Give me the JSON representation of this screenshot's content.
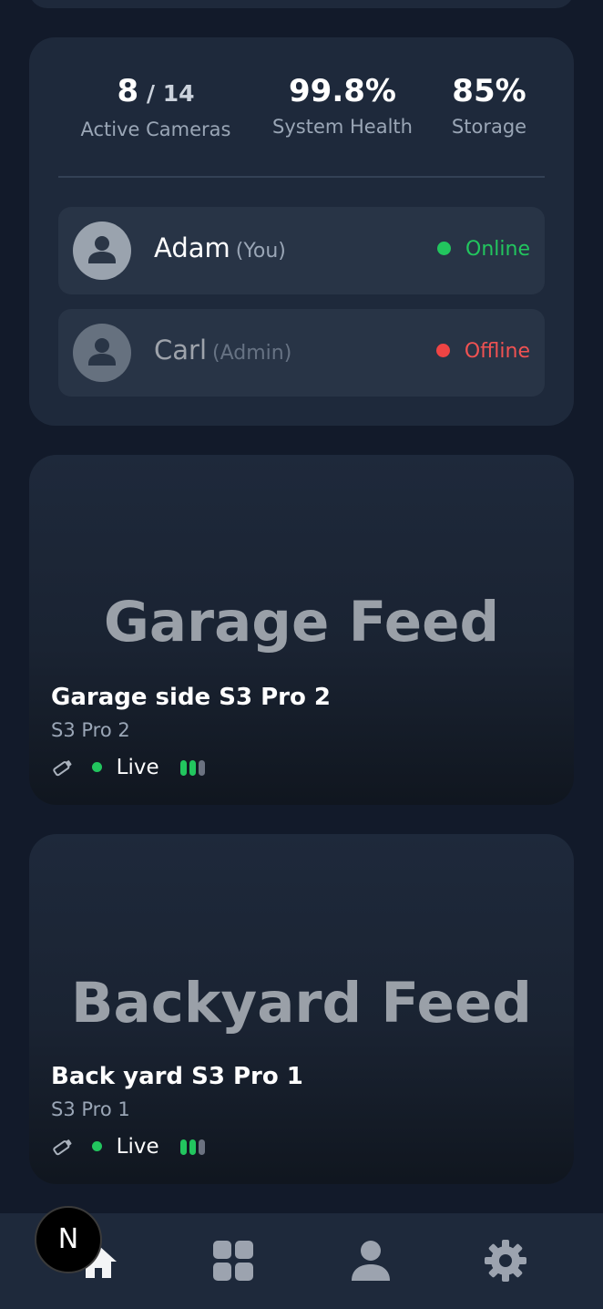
{
  "stats": {
    "active_cameras": {
      "value": "8",
      "total": "/ 14",
      "label": "Active Cameras"
    },
    "system_health": {
      "value": "99.8%",
      "label": "System Health"
    },
    "storage": {
      "value": "85%",
      "label": "Storage"
    }
  },
  "users": [
    {
      "name": "Adam",
      "role": "(You)",
      "status": "Online",
      "status_color": "#22c55e"
    },
    {
      "name": "Carl",
      "role": "(Admin)",
      "status": "Offline",
      "status_color": "#ef4444"
    }
  ],
  "feeds": [
    {
      "placeholder": "Garage Feed",
      "title": "Garage side S3 Pro 2",
      "model": "S3 Pro 2",
      "live_label": "Live",
      "signal_bars": 2,
      "signal_max": 3
    },
    {
      "placeholder": "Backyard Feed",
      "title": "Back yard S3 Pro 1",
      "model": "S3 Pro 1",
      "live_label": "Live",
      "signal_bars": 2,
      "signal_max": 3
    }
  ],
  "nav": {
    "items": [
      "home-icon",
      "grid-icon",
      "user-icon",
      "gear-icon"
    ],
    "badge_letter": "N"
  },
  "colors": {
    "background": "#121a2a",
    "card": "#1e293b",
    "online": "#22c55e",
    "offline": "#ef4444"
  }
}
